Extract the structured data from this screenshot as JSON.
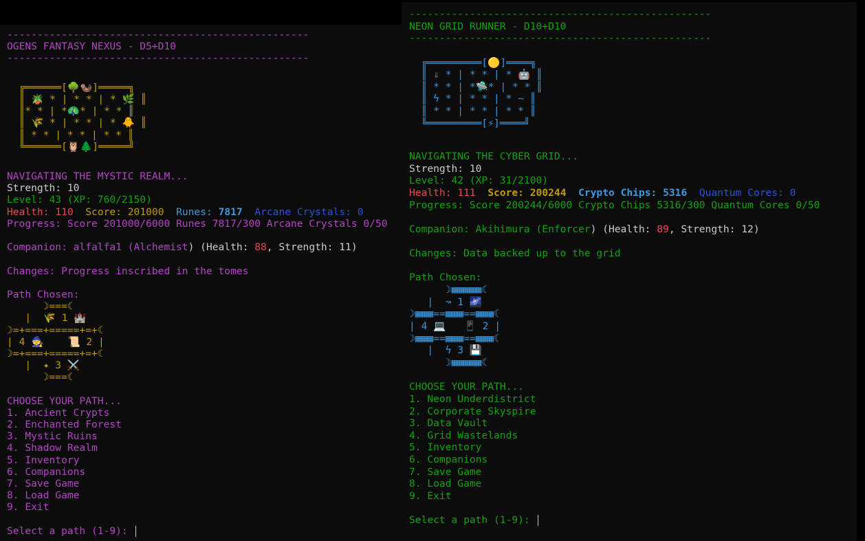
{
  "left": {
    "separator": "--------------------------------------------------",
    "title": "OGENS FANTASY NEXUS - D5+D10",
    "map": [
      "  ╔══════[🌳🦦]═════╗",
      "  ║ 🪴 * | * * | * 🌿 ║",
      "  ║* * | *🦚* | * * ║",
      "  ║ 🌾 * | * * | * 🐥 ║",
      "  ║ * * | * * | * * ║",
      "  ╚══════[🦉🌲]═════╝"
    ],
    "status_heading": "NAVIGATING THE MYSTIC REALM...",
    "strength_label": "Strength:",
    "strength_value": "10",
    "level_text": "Level: 43 (XP: 760/2150)",
    "health_label": "Health:",
    "health_value": "110",
    "score_label": "Score:",
    "score_value": "201000",
    "res1_label": "Runes:",
    "res1_value": "7817",
    "res2_label": "Arcane Crystals:",
    "res2_value": "0",
    "progress_text": "Progress: Score 201000/6000 Runes 7817/300 Arcane Crystals 0/50",
    "companion_prefix": "Companion: alfalfa1 (Alchemist",
    "companion_paren": ") (Health: ",
    "companion_health": "88",
    "companion_strength": ", Strength: 11)",
    "changes_text": "Changes: Progress inscribed in the tomes",
    "path_heading": "Path Chosen:",
    "path_art": [
      "      ☽===☾",
      "   |  🌾 1 🏰",
      "☽=+===+=====+=+☾",
      "| 4 🧙    📜 2 |",
      "☽=+===+=====+=+☾",
      "   |  ✦ 3 ⚔️",
      "      ☽===☾"
    ],
    "choose_heading": "CHOOSE YOUR PATH...",
    "options": [
      "1. Ancient Crypts",
      "2. Enchanted Forest",
      "3. Mystic Ruins",
      "4. Shadow Realm",
      "5. Inventory",
      "6. Companions",
      "7. Save Game",
      "8. Load Game",
      "9. Exit"
    ],
    "prompt": "Select a path (1-9): "
  },
  "right": {
    "separator": "--------------------------------------------------",
    "title": "NEON GRID RUNNER - D10+D10",
    "map": [
      "  ╔═════════[🟡]════╗",
      "  ║ ⇓ * | * * | * 🤖 ║",
      "  ║ * * | *🛸* | * * ║",
      "  ║ ϟ * | * * | * ~ ║",
      "  ║ * * | * * | * * ║",
      "  ╚═════════[⚡]════╝"
    ],
    "status_heading": "NAVIGATING THE CYBER GRID...",
    "strength_label": "Strength:",
    "strength_value": "10",
    "level_text": "Level: 42 (XP: 31/2100)",
    "health_label": "Health:",
    "health_value": "111",
    "score_label": "Score:",
    "score_value": "200244",
    "res1_label": "Crypto Chips:",
    "res1_value": "5316",
    "res2_label": "Quantum Cores:",
    "res2_value": "0",
    "progress_text": "Progress: Score 200244/6000 Crypto Chips 5316/300 Quantum Cores 0/50",
    "companion_prefix": "Companion: Akihimura (Enforcer",
    "companion_paren": ") (Health: ",
    "companion_health": "89",
    "companion_strength": ", Strength: 12)",
    "changes_text": "Changes: Data backed up to the grid",
    "path_heading": "Path Chosen:",
    "path_art": [
      "      ☽▦▦▦▦▦☾",
      "   |  ↝ 1 🌌",
      "☽▦▦▦==▦▦▦==▦▦▦☾",
      "| 4 💻   📱 2 |",
      "☽▦▦▦==▦▦▦==▦▦▦☾",
      "   |  ϟ 3 💾",
      "      ☽▦▦▦▦▦☾"
    ],
    "choose_heading": "CHOOSE YOUR PATH...",
    "options": [
      "1. Neon Underdistrict",
      "2. Corporate Skyspire",
      "3. Data Vault",
      "4. Grid Wastelands",
      "5. Inventory",
      "6. Companions",
      "7. Save Game",
      "8. Load Game",
      "9. Exit"
    ],
    "prompt": "Select a path (1-9): "
  }
}
